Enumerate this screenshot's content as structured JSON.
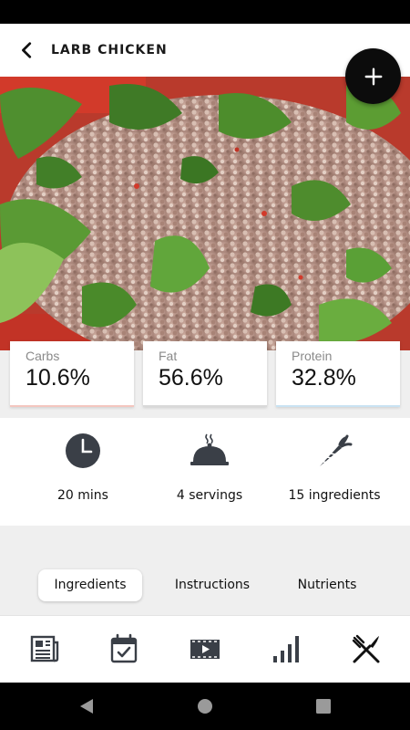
{
  "app_bar": {
    "title": "LARB CHICKEN",
    "back_icon": "chevron-left-icon",
    "add_icon": "plus-icon"
  },
  "hero": {
    "image": "photo of larb chicken salad with minced chicken and fresh herbs"
  },
  "macros": [
    {
      "label": "Carbs",
      "value": "10.6%",
      "accent": "#f4c6bf"
    },
    {
      "label": "Fat",
      "value": "56.6%",
      "accent": "#d9d9d9"
    },
    {
      "label": "Protein",
      "value": "32.8%",
      "accent": "#c9e3f3"
    }
  ],
  "info": [
    {
      "icon": "clock-icon",
      "label": "20 mins"
    },
    {
      "icon": "serving-dish-icon",
      "label": "4 servings"
    },
    {
      "icon": "carrot-icon",
      "label": "15 ingredients"
    }
  ],
  "tabs": [
    {
      "label": "Ingredients",
      "active": true
    },
    {
      "label": "Instructions",
      "active": false
    },
    {
      "label": "Nutrients",
      "active": false
    }
  ],
  "bottom_nav": [
    {
      "icon": "news-icon"
    },
    {
      "icon": "calendar-check-icon"
    },
    {
      "icon": "video-icon"
    },
    {
      "icon": "bar-chart-icon"
    },
    {
      "icon": "fork-knife-icon"
    }
  ],
  "system_nav": [
    {
      "icon": "back-triangle-icon"
    },
    {
      "icon": "home-circle-icon"
    },
    {
      "icon": "recents-square-icon"
    }
  ],
  "colors": {
    "primary_dark": "#0c0c0c",
    "icon_gray": "#3a3f47",
    "background_gray": "#efefef"
  }
}
